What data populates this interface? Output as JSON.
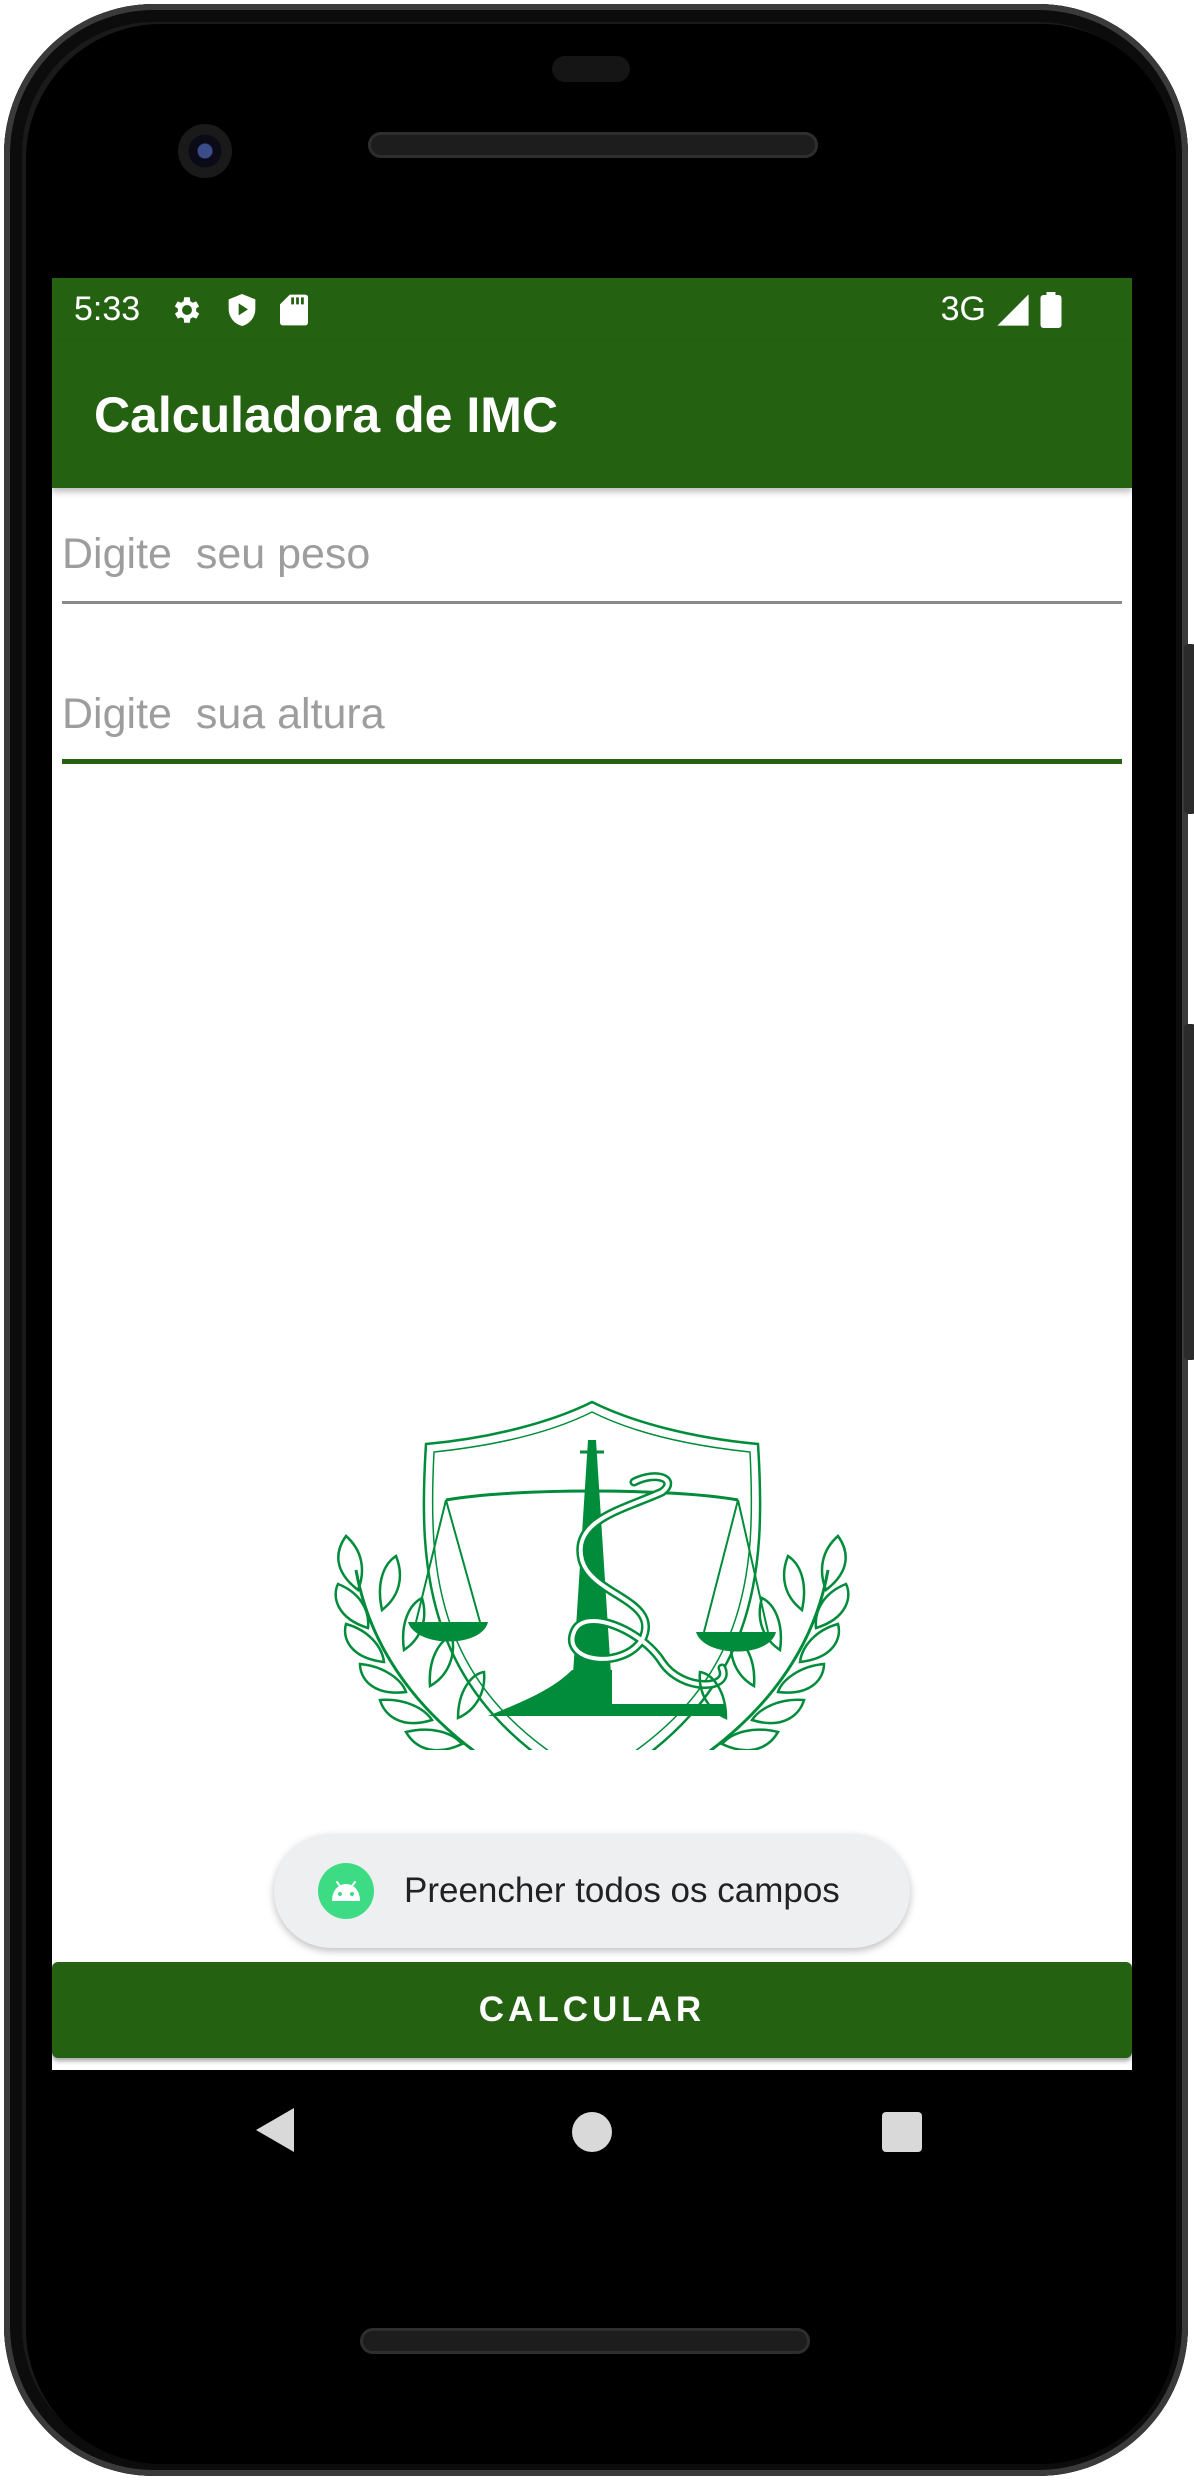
{
  "status_bar": {
    "time": "5:33",
    "network": "3G",
    "icons": [
      "settings-icon",
      "shield-play-icon",
      "sd-card-icon",
      "signal-icon",
      "battery-icon"
    ]
  },
  "app_bar": {
    "title": "Calculadora de IMC"
  },
  "form": {
    "weight": {
      "placeholder": "Digite  seu peso",
      "value": ""
    },
    "height": {
      "placeholder": "Digite  sua altura",
      "value": ""
    }
  },
  "emblem": {
    "icon": "medicine-law-emblem"
  },
  "toast": {
    "message": "Preencher todos os campos",
    "icon": "android-icon"
  },
  "calculate_button": {
    "label": "CALCULAR"
  },
  "nav": {
    "icons": [
      "back-icon",
      "home-icon",
      "recents-icon"
    ]
  },
  "colors": {
    "primary": "#246212",
    "accent": "#008c3a",
    "toast_bg": "#eeeff1",
    "android_green": "#3ddc84"
  }
}
